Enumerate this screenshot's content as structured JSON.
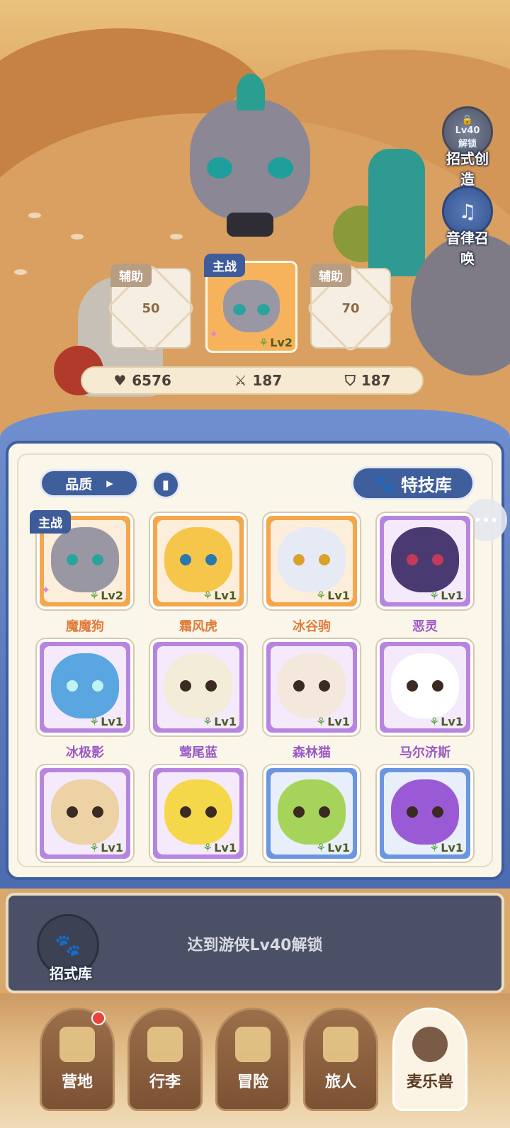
{
  "side_buttons": [
    {
      "lock_line1": "Lv40",
      "lock_line2": "解锁",
      "label": "招式创造",
      "icon": "lock-icon"
    },
    {
      "label": "音律召唤",
      "icon": "harp-icon"
    }
  ],
  "team": {
    "left": {
      "tag": "辅助",
      "unlock_level": "50"
    },
    "main": {
      "tag": "主战",
      "level": "Lv2"
    },
    "right": {
      "tag": "辅助",
      "unlock_level": "70"
    }
  },
  "stats": {
    "hp": "6576",
    "attack": "187",
    "defense": "187"
  },
  "panel": {
    "quality_label": "品质",
    "skill_library_label": "特技库"
  },
  "pets": [
    {
      "name": "魔魔狗",
      "level": "Lv2",
      "rarity": "orange",
      "main": "主战"
    },
    {
      "name": "霜风虎",
      "level": "Lv1",
      "rarity": "orange"
    },
    {
      "name": "冰谷驹",
      "level": "Lv1",
      "rarity": "orange"
    },
    {
      "name": "恶灵",
      "level": "Lv1",
      "rarity": "purple"
    },
    {
      "name": "冰极影",
      "level": "Lv1",
      "rarity": "purple"
    },
    {
      "name": "莺尾蓝",
      "level": "Lv1",
      "rarity": "purple"
    },
    {
      "name": "森林猫",
      "level": "Lv1",
      "rarity": "purple"
    },
    {
      "name": "马尔济斯",
      "level": "Lv1",
      "rarity": "purple"
    },
    {
      "name": "",
      "level": "Lv1",
      "rarity": "purple"
    },
    {
      "name": "",
      "level": "Lv1",
      "rarity": "purple"
    },
    {
      "name": "",
      "level": "Lv1",
      "rarity": "blue"
    },
    {
      "name": "",
      "level": "Lv1",
      "rarity": "blue"
    }
  ],
  "move_library": {
    "label": "招式库",
    "lock_text": "达到游侠Lv40解锁"
  },
  "nav": [
    {
      "label": "营地",
      "badge": true
    },
    {
      "label": "行李"
    },
    {
      "label": "冒险"
    },
    {
      "label": "旅人"
    },
    {
      "label": "麦乐兽",
      "active": true
    }
  ],
  "colors": {
    "accent_blue": "#3f5e9c",
    "orange_rarity": "#f5a64a",
    "purple_rarity": "#b885de",
    "blue_rarity": "#6b96df",
    "name_orange": "#e07c3a",
    "name_purple": "#9a58c8"
  }
}
